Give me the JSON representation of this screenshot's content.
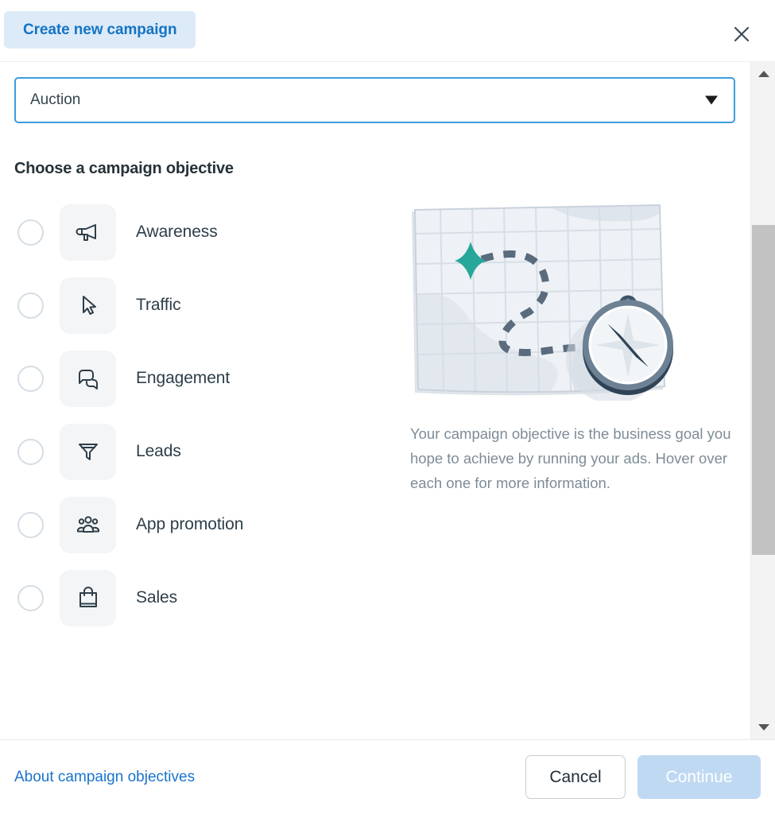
{
  "header": {
    "tab_label": "Create new campaign",
    "close_icon": "close-icon"
  },
  "buying_type": {
    "label": "Auction",
    "caret_icon": "chevron-down-icon"
  },
  "section": {
    "title": "Choose a campaign objective"
  },
  "objectives": [
    {
      "label": "Awareness",
      "icon": "megaphone-icon",
      "selected": false
    },
    {
      "label": "Traffic",
      "icon": "cursor-arrow-icon",
      "selected": false
    },
    {
      "label": "Engagement",
      "icon": "chat-bubbles-icon",
      "selected": false
    },
    {
      "label": "Leads",
      "icon": "funnel-icon",
      "selected": false
    },
    {
      "label": "App promotion",
      "icon": "people-group-icon",
      "selected": false
    },
    {
      "label": "Sales",
      "icon": "shopping-bag-icon",
      "selected": false
    }
  ],
  "illustration": {
    "name": "map-with-compass-illustration",
    "star_color": "#27a69a",
    "compass_dark": "#2e4356",
    "map_paper": "#eef2f6",
    "path_color": "#5a6b7d"
  },
  "description": {
    "text": "Your campaign objective is the business goal you hope to achieve by running your ads. Hover over each one for more information."
  },
  "scrollbar": {
    "up_icon": "triangle-up-icon",
    "down_icon": "triangle-down-icon"
  },
  "footer": {
    "about_link": "About campaign objectives",
    "cancel_label": "Cancel",
    "continue_label": "Continue"
  },
  "colors": {
    "accent_blue": "#1474c4",
    "tab_bg": "#ddeaf7",
    "focus_border": "#3c9ddd",
    "continue_disabled": "#bfd9f2",
    "icon_tile_bg": "#f4f5f7",
    "text_dark": "#2e3e49",
    "text_muted": "#7e8c96"
  }
}
